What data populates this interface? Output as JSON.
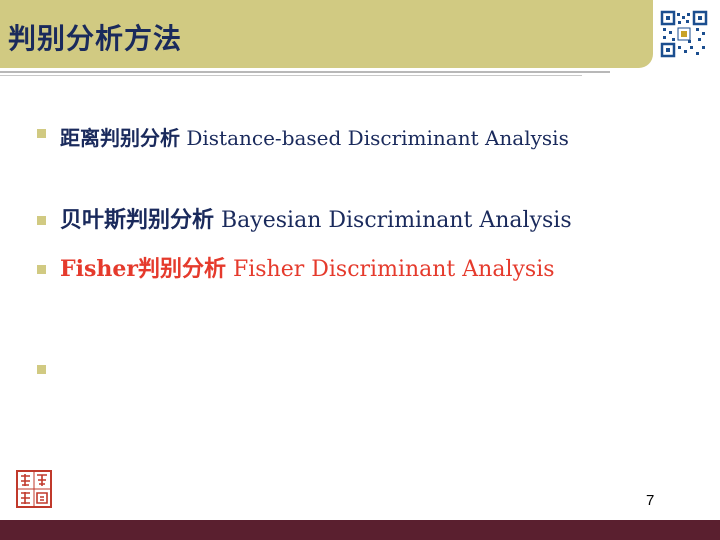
{
  "slide": {
    "title": "判别分析方法",
    "page_number": "7",
    "bullet_items": [
      {
        "zh": "距离判别分析",
        "en": "Distance-based Discriminant Analysis"
      },
      {
        "zh": "贝叶斯判别分析",
        "en": "Bayesian Discriminant Analysis"
      },
      {
        "zh": "Fisher判别分析",
        "en": "Fisher Discriminant Analysis",
        "highlight": true
      },
      {
        "zh": "",
        "en": ""
      }
    ]
  },
  "colors": {
    "title_bar": "#d1ca82",
    "text": "#1a2a5c",
    "highlight": "#e53a2c",
    "bottom_bar": "#5a1f2f"
  },
  "icons": {
    "qr": "qr-code-icon",
    "seal": "red-seal-logo"
  }
}
